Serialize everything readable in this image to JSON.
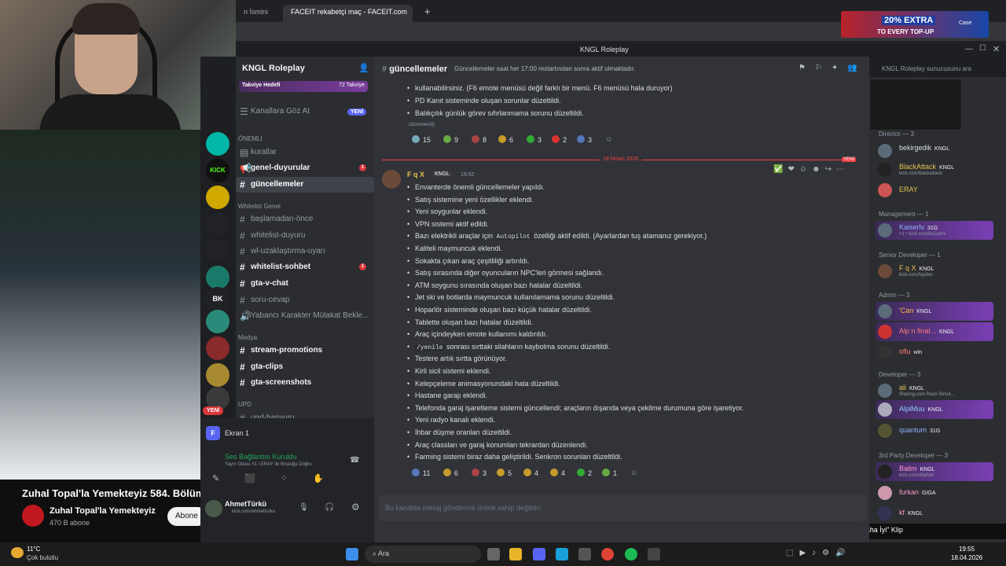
{
  "browser": {
    "tabs": [
      {
        "label": "n İsmini"
      },
      {
        "label": "FACEIT rekabetçi maç - FACEIT.com"
      }
    ],
    "ad": {
      "headline": "20% EXTRA",
      "sub": "TO EVERY TOP-UP",
      "brand": "Case"
    },
    "window_title": "KNGL Roleplay"
  },
  "stream": {
    "video_title": "Zuhal Topal'la Yemekteyiz 584. Bölüm",
    "channel": "Zuhal Topal'la Yemekteyiz",
    "subscribers": "470 B abone",
    "subscribe_label": "Abone"
  },
  "servers": [
    "YENİ",
    "BK",
    "KICK"
  ],
  "sidebar": {
    "server_name": "KNGL Roleplay",
    "boost": {
      "label": "Takviye Hedefi",
      "count": "72 Takviye"
    },
    "browse": "Kanallara Göz At",
    "browse_badge": "YENİ",
    "cat_important": "ÖNEMLİ",
    "ch_kurallar": "kurallar",
    "ch_genel": "genel-duyurular",
    "ch_guncel": "güncellemeler",
    "cat_whitelist": "Whitelist Genel",
    "ch_basla": "başlamadan-önce",
    "ch_wlduyuru": "whitelist-duyuru",
    "ch_wluzak": "wl-uzaklaştırma-uyarı",
    "ch_wlsohbet": "whitelist-sohbet",
    "ch_gtavchat": "gta-v-chat",
    "ch_soru": "soru-cevap",
    "ch_yabanci": "Yabancı Karakter Mülakat Bekle...",
    "cat_medya": "Medya",
    "ch_stream": "stream-promotions",
    "ch_clips": "gta-clips",
    "ch_ss": "gta-screenshots",
    "cat_upd": "UPD",
    "ch_upd": "upd-basvuru"
  },
  "userpanel": {
    "screen": "Ekran 1",
    "voice_status": "Ses Bağlantısı Kuruldu",
    "voice_sub": "Yayın Odası #1 / ERAY ile Boşluğa Doğru",
    "username": "AhmetTürkü",
    "user_status": "kick.com/ahmetturku"
  },
  "chat": {
    "channel": "güncellemeler",
    "topic": "Güncellemeler saat her 17:00 restartından sonra aktif olmaktadır.",
    "prev_lines": [
      "kullanabilirsiniz. (F6 emote menüsü değil farklı bir menü. F6 menüsü hala duruyor)",
      "PD Kanıt sisteminde oluşan sorunlar düzeltildi.",
      "Balıkçılık günlük görev sıfırlanmama sorunu düzeltildi."
    ],
    "edited": "(düzenlendi)",
    "prev_reactions": [
      "15",
      "9",
      "8",
      "6",
      "3",
      "2",
      "3"
    ],
    "date_divider": "18 Nisan 2026",
    "new_label": "YENİ",
    "author": "F q X",
    "author_tag": "KNGL",
    "time": "19:52",
    "lines": [
      "Envanterde önemli güncellemeler yapıldı.",
      "Satış sistemine yeni özellikler eklendi.",
      "Yeni soygunlar eklendi.",
      "VPN sistemi aktif edildi.",
      "",
      "Kaliteli maymuncuk eklendi.",
      "Sokakta çıkan araç çeşitliliği artırıldı.",
      "Satış sırasında diğer oyuncuların NPC'leri görmesi sağlandı.",
      "ATM soygunu sırasında oluşan bazı hatalar düzeltildi.",
      "Jet ski ve botlarda maymuncuk kullanılamama sorunu düzeltildi.",
      "Hoparlör sisteminde oluşan bazı küçük hatalar düzeltildi.",
      "Tablette oluşan bazı hatalar düzeltildi.",
      "Araç içindeyken emote kullanımı kaldırıldı.",
      "",
      "Testere artık sırtta görünüyor.",
      "Kirli sicil sistemi eklendi.",
      "Kelepçeleme animasyonundaki hata düzeltildi.",
      "Hastane garajı eklendi.",
      "Telefonda garaj işaretleme sistemi güncellendi; araçların dışarıda veya çekilme durumuna göre işaretiyor.",
      "Yeni radyo kanalı eklendi.",
      "İhbar düşme oranları düzeltildi.",
      "Araç classları ve garaj konumları tekrardan düzenlendi.",
      "Farming sistemi biraz daha geliştirildi. Senkron sorunları düzeltildi."
    ],
    "line5_pre": "Bazı elektrikli araçlar için",
    "line5_code": "Autopilot",
    "line5_post": "özelliği aktif edildi. (Ayarlardan tuş atamanız gerekiyor.)",
    "line14_code": "/yenile",
    "line14_post": "sonrası sırttaki silahların kaybolma sorunu düzeltildi.",
    "reactions": [
      "11",
      "6",
      "3",
      "5",
      "4",
      "4",
      "2",
      "1"
    ],
    "input_placeholder": "Bu kanalda mesaj gönderme iznine sahip değilsin.",
    "search_placeholder": "KNGL Roleplay sunucusunu ara"
  },
  "members": {
    "director_header": "Director — 3",
    "m1": "bekirgedik",
    "m2": "BlackAttack",
    "m2s": "kick.com/blackattack",
    "m3": "ERAY",
    "mgmt_header": "Management — 1",
    "m4": "Kaiserlv",
    "m4s": "+1 • kick.com/ka1serlv",
    "sr_header": "Senior Developer — 1",
    "m5": "F q X",
    "m5s": "kick.com/fqxdev",
    "admin_header": "Admin — 3",
    "m6": "'Can",
    "m7": "Alp n final...",
    "m8": "oflu",
    "dev_header": "Developer — 3",
    "m9": "ali",
    "m9s": "iRacing.com Race Simul...",
    "m10": "AlpiMuu",
    "m11": "quantum",
    "tpd_header": "3rd Party Developer — 3",
    "m12": "Balim",
    "m12s": "kick.com/dilahoo",
    "m13": "furkan",
    "m14": "kf",
    "tag_kngl": "KNGL",
    "tag_31g": "31G",
    "tag_win": "win",
    "tag_giga": "GIGA"
  },
  "taskbar": {
    "weather": "11°C",
    "weather_sub": "Çok bulutlu",
    "search": "Ara",
    "time": "19:55",
    "date": "18.04.2026",
    "clip_label": "\"Daha İyi\" Klip"
  }
}
